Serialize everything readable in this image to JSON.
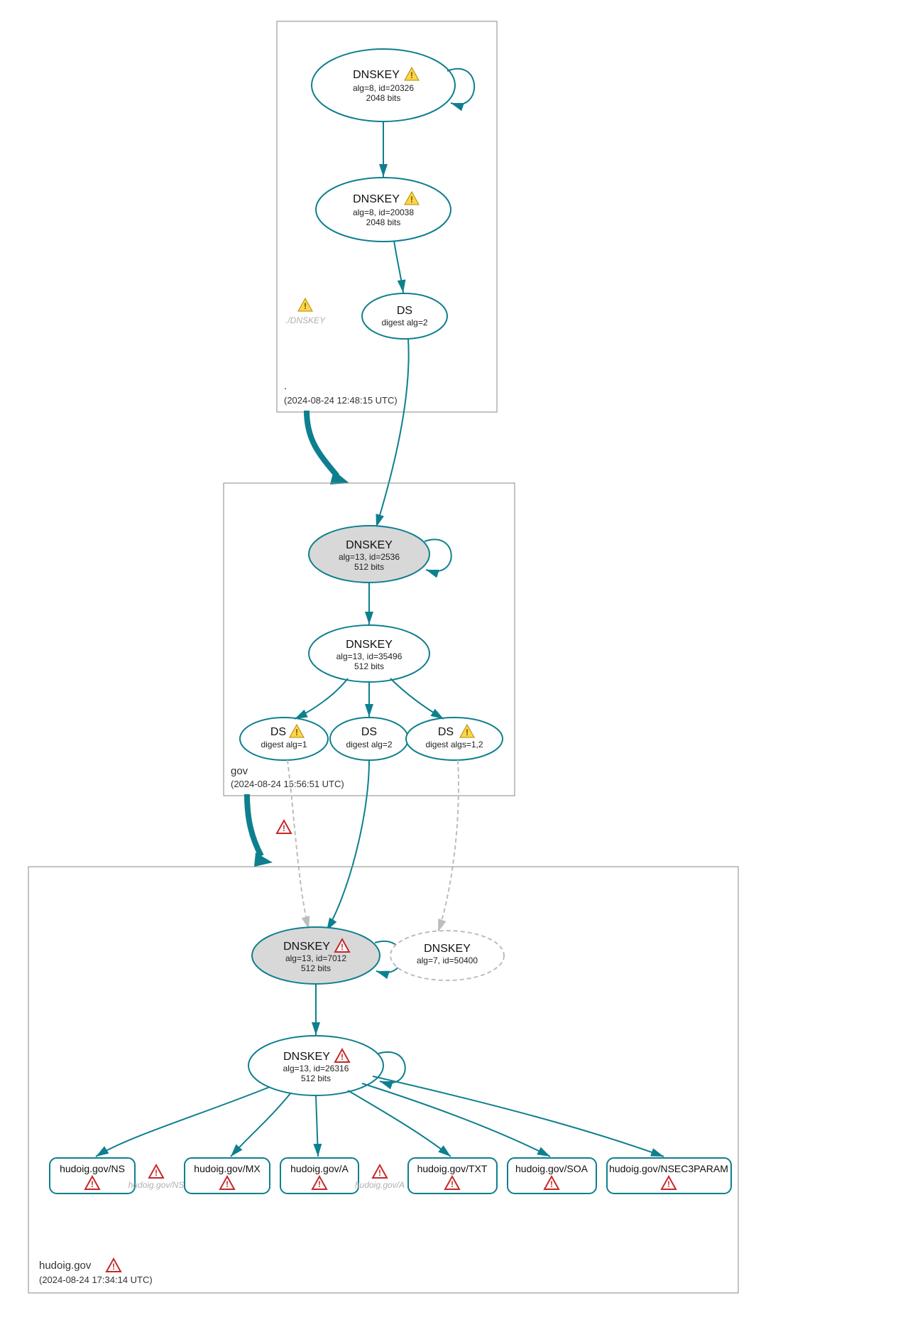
{
  "zones": {
    "root": {
      "label": ".",
      "time": "(2024-08-24 12:48:15 UTC)"
    },
    "gov": {
      "label": "gov",
      "time": "(2024-08-24 15:56:51 UTC)"
    },
    "hudoig": {
      "label": "hudoig.gov",
      "time": "(2024-08-24 17:34:14 UTC)"
    }
  },
  "nodes": {
    "root_ksk": {
      "title": "DNSKEY",
      "line1": "alg=8, id=20326",
      "line2": "2048 bits",
      "warn": true
    },
    "root_zsk": {
      "title": "DNSKEY",
      "line1": "alg=8, id=20038",
      "line2": "2048 bits",
      "warn": true
    },
    "root_ghost": {
      "label": "./DNSKEY"
    },
    "root_ds": {
      "title": "DS",
      "line1": "digest alg=2"
    },
    "gov_ksk": {
      "title": "DNSKEY",
      "line1": "alg=13, id=2536",
      "line2": "512 bits"
    },
    "gov_zsk": {
      "title": "DNSKEY",
      "line1": "alg=13, id=35496",
      "line2": "512 bits"
    },
    "gov_ds1": {
      "title": "DS",
      "line1": "digest alg=1",
      "warn": true
    },
    "gov_ds2": {
      "title": "DS",
      "line1": "digest alg=2"
    },
    "gov_ds3": {
      "title": "DS",
      "line1": "digest algs=1,2",
      "warn": true
    },
    "hud_ksk": {
      "title": "DNSKEY",
      "line1": "alg=13, id=7012",
      "line2": "512 bits",
      "err": true
    },
    "hud_ghost": {
      "title": "DNSKEY",
      "line1": "alg=7, id=50400"
    },
    "hud_zsk": {
      "title": "DNSKEY",
      "line1": "alg=13, id=26316",
      "line2": "512 bits",
      "err": true
    },
    "ghost_ns": {
      "label": "hudoig.gov/NS"
    },
    "ghost_a": {
      "label": "hudoig.gov/A"
    }
  },
  "records": [
    {
      "label": "hudoig.gov/NS"
    },
    {
      "label": "hudoig.gov/MX"
    },
    {
      "label": "hudoig.gov/A"
    },
    {
      "label": "hudoig.gov/TXT"
    },
    {
      "label": "hudoig.gov/SOA"
    },
    {
      "label": "hudoig.gov/NSEC3PARAM"
    }
  ]
}
